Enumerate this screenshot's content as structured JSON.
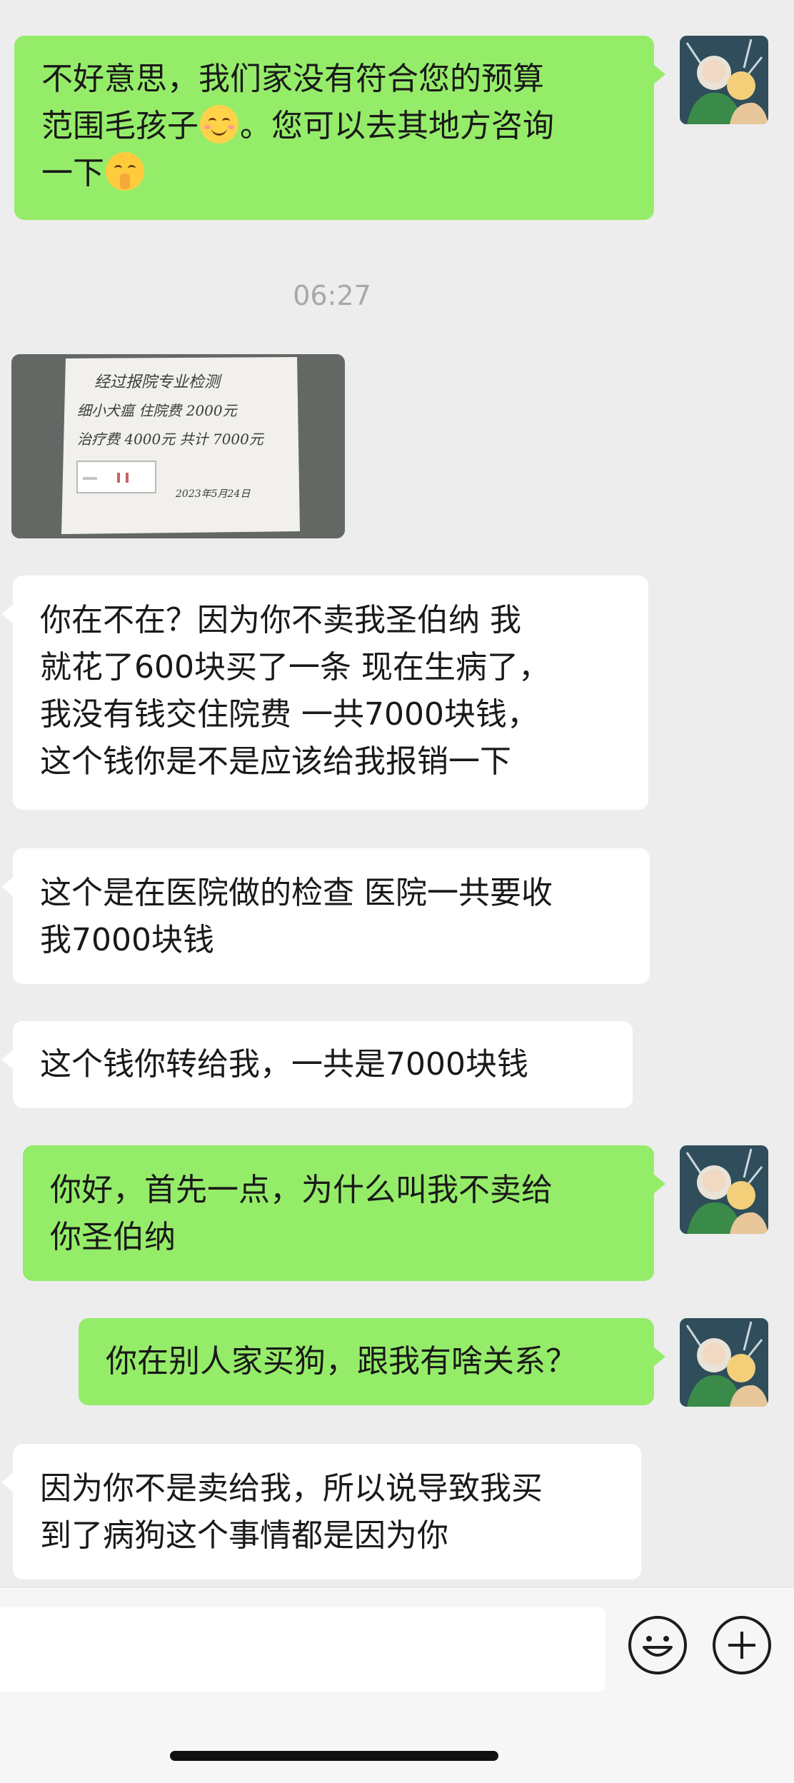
{
  "timestamp": "06:27",
  "messages": [
    {
      "side": "me",
      "lines": [
        "不好意思，我们家没有符合您的预算",
        "范围毛孩子",
        "。您可以去其地方咨询",
        "一下"
      ]
    },
    {
      "side": "them",
      "lines": [
        "你在不在？因为你不卖我圣伯纳  我",
        "就花了600块买了一条  现在生病了，",
        "我没有钱交住院费 一共7000块钱，",
        "这个钱你是不是应该给我报销一下"
      ]
    },
    {
      "side": "them",
      "lines": [
        "这个是在医院做的检查 医院一共要收",
        "我7000块钱"
      ]
    },
    {
      "side": "them",
      "lines": [
        "这个钱你转给我，一共是7000块钱"
      ]
    },
    {
      "side": "me",
      "lines": [
        "你好，首先一点，为什么叫我不卖给",
        "你圣伯纳"
      ]
    },
    {
      "side": "me",
      "lines": [
        "你在别人家买狗，跟我有啥关系？"
      ]
    },
    {
      "side": "them",
      "lines": [
        "因为你不是卖给我，所以说导致我买",
        "到了病狗这个事情都是因为你"
      ]
    }
  ],
  "photo_note": {
    "lines": [
      "经过报院专业检测",
      "细小犬瘟  住院费 2000元",
      "治疗费 4000元  共计 7000元",
      "2023年5月24日"
    ]
  },
  "icons": {
    "avatar": "avatar-icon",
    "emoji_smile": "smiling-face-emoji",
    "emoji_shush": "shushing-face-emoji",
    "emoji_button": "emoji-icon",
    "plus_button": "plus-icon"
  },
  "colors": {
    "me_bubble": "#95ec69",
    "them_bubble": "#ffffff",
    "background": "#ededed"
  }
}
